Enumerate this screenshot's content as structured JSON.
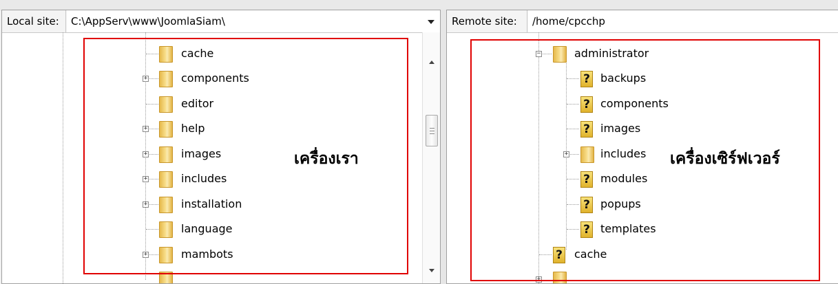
{
  "local": {
    "label": "Local site:",
    "path": "C:\\AppServ\\www\\JoomlaSiam\\",
    "items": [
      {
        "name": "cache",
        "expandable": false
      },
      {
        "name": "components",
        "expandable": true
      },
      {
        "name": "editor",
        "expandable": false
      },
      {
        "name": "help",
        "expandable": true
      },
      {
        "name": "images",
        "expandable": true
      },
      {
        "name": "includes",
        "expandable": true
      },
      {
        "name": "installation",
        "expandable": true
      },
      {
        "name": "language",
        "expandable": false
      },
      {
        "name": "mambots",
        "expandable": true
      }
    ],
    "caption": "เครื่องเรา"
  },
  "remote": {
    "label": "Remote site:",
    "path": "/home/cpcchp",
    "parent": "administrator",
    "children": [
      {
        "name": "backups",
        "icon": "question-icon"
      },
      {
        "name": "components",
        "icon": "question-icon"
      },
      {
        "name": "images",
        "icon": "question-icon"
      },
      {
        "name": "includes",
        "icon": "folder-icon",
        "expandable": true
      },
      {
        "name": "modules",
        "icon": "question-icon"
      },
      {
        "name": "popups",
        "icon": "question-icon"
      },
      {
        "name": "templates",
        "icon": "question-icon"
      }
    ],
    "sibling": "cache",
    "caption": "เครื่องเซิร์ฟเวอร์"
  },
  "colors": {
    "highlight": "#e00000",
    "folder": "#f3cf6a"
  }
}
